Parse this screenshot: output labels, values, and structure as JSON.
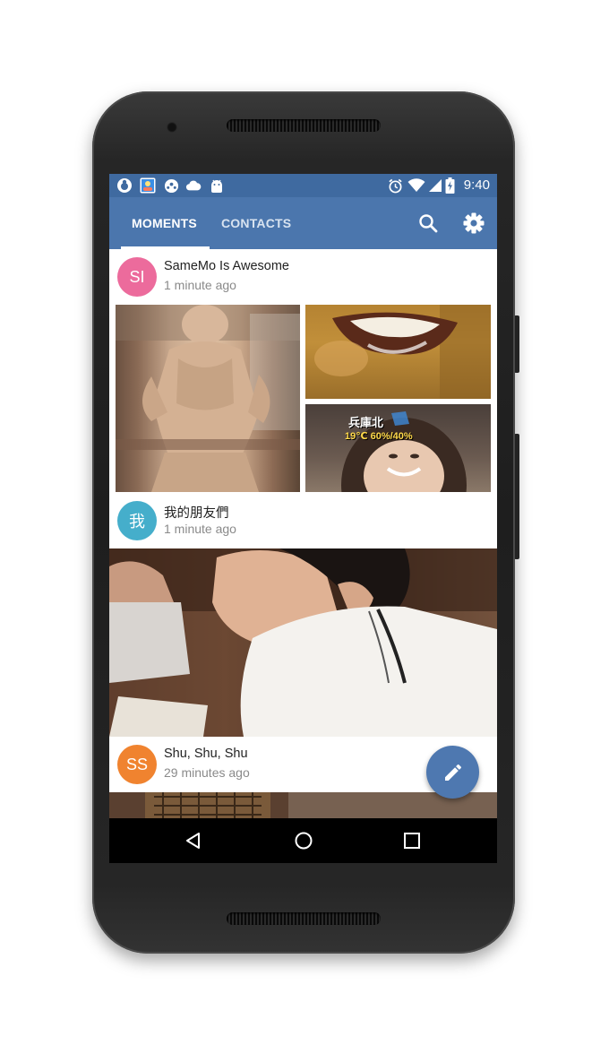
{
  "status_bar": {
    "time": "9:40",
    "left_icons": [
      "app-icon",
      "contacts-app-icon",
      "soccer-icon",
      "cloud-icon",
      "android-icon"
    ],
    "right_icons": [
      "alarm-icon",
      "wifi-icon",
      "signal-icon",
      "battery-charging-icon"
    ]
  },
  "app_bar": {
    "tabs": [
      {
        "label": "MOMENTS",
        "active": true
      },
      {
        "label": "CONTACTS",
        "active": false
      }
    ],
    "actions": [
      "search-icon",
      "settings-icon"
    ]
  },
  "feed": {
    "posts": [
      {
        "initials": "SI",
        "name": "SameMo Is Awesome",
        "time": "1 minute ago",
        "avatar_color": "#ec6b9c"
      },
      {
        "initials": "我",
        "name": "我的朋友們",
        "time": "1 minute ago",
        "avatar_color": "#45aecb"
      },
      {
        "initials": "SS",
        "name": "Shu, Shu, Shu",
        "time": "29 minutes ago",
        "avatar_color": "#f0832f"
      }
    ],
    "photo_overlay": {
      "location": "兵庫北",
      "weather": "19℃ 60%/40%"
    }
  },
  "fab": {
    "icon": "pencil-icon"
  },
  "nav_bar": {
    "icons": [
      "back-icon",
      "home-icon",
      "recents-icon"
    ]
  },
  "colors": {
    "status_bar": "#3f6aa0",
    "app_bar": "#4b76ad",
    "fab": "#4e78b0"
  }
}
